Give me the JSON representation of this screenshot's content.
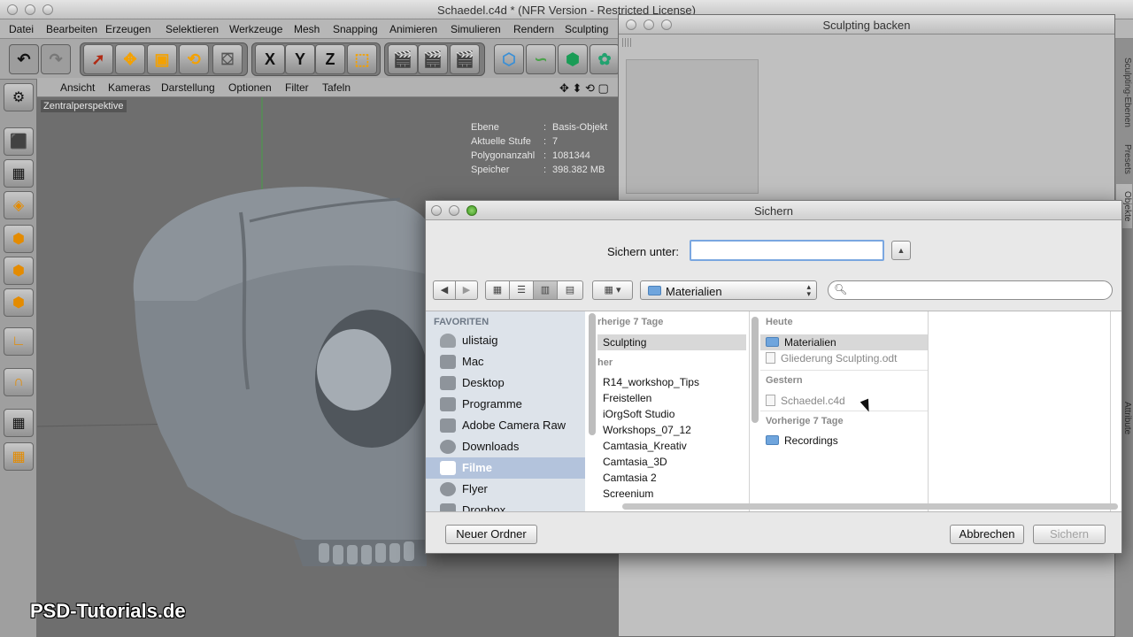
{
  "window": {
    "title": "Schaedel.c4d * (NFR Version - Restricted License)"
  },
  "menubar": [
    "Datei",
    "Bearbeiten",
    "Erzeugen",
    "Selektieren",
    "Werkzeuge",
    "Mesh",
    "Snapping",
    "Animieren",
    "Simulieren",
    "Rendern",
    "Sculpting"
  ],
  "axis_buttons": [
    "X",
    "Y",
    "Z"
  ],
  "view_menu": [
    "Ansicht",
    "Kameras",
    "Darstellung",
    "Optionen",
    "Filter",
    "Tafeln"
  ],
  "viewport": {
    "perspective_label": "Zentralperspektive",
    "hud": [
      {
        "key": "Ebene",
        "value": "Basis-Objekt"
      },
      {
        "key": "Aktuelle Stufe",
        "value": "7"
      },
      {
        "key": "Polygonanzahl",
        "value": "1081344"
      },
      {
        "key": "Speicher",
        "value": "398.382 MB"
      }
    ]
  },
  "side_tabs": [
    "Sculpting-Ebenen",
    "Presets",
    "Objekte",
    "Attribute"
  ],
  "bake_window": {
    "title": "Sculpting backen"
  },
  "dialog": {
    "title": "Sichern",
    "saveas_label": "Sichern unter:",
    "saveas_value": "",
    "path_popup": "Materialien",
    "search_placeholder": "",
    "sidebar_heading": "FAVORITEN",
    "sidebar_items": [
      "ulistaig",
      "Mac",
      "Desktop",
      "Programme",
      "Adobe Camera Raw",
      "Downloads",
      "Filme",
      "Flyer",
      "Dropbox"
    ],
    "sidebar_selected": "Filme",
    "column1": {
      "heading_top": "rherige 7 Tage",
      "selected_item": "Sculpting",
      "heading_mid": "her",
      "items": [
        "R14_workshop_Tips",
        "Freistellen",
        "iOrgSoft Studio",
        "Workshops_07_12",
        "Camtasia_Kreativ",
        "Camtasia_3D",
        "Camtasia 2",
        "Screenium"
      ]
    },
    "column2": {
      "heading_today": "Heute",
      "today_folder": "Materialien",
      "today_file": "Gliederung Sculpting.odt",
      "heading_yesterday": "Gestern",
      "yesterday_file": "Schaedel.c4d",
      "heading_prev": "Vorherige 7 Tage",
      "prev_folder": "Recordings"
    },
    "buttons": {
      "new_folder": "Neuer Ordner",
      "cancel": "Abbrechen",
      "save": "Sichern"
    }
  },
  "watermark": "PSD-Tutorials.de",
  "colors": {
    "selection_blue": "#b3c3dc",
    "focus_ring": "#7aa7e0",
    "folder_blue": "#6fa5dd",
    "viewport_grey": "#6e6e6e"
  }
}
